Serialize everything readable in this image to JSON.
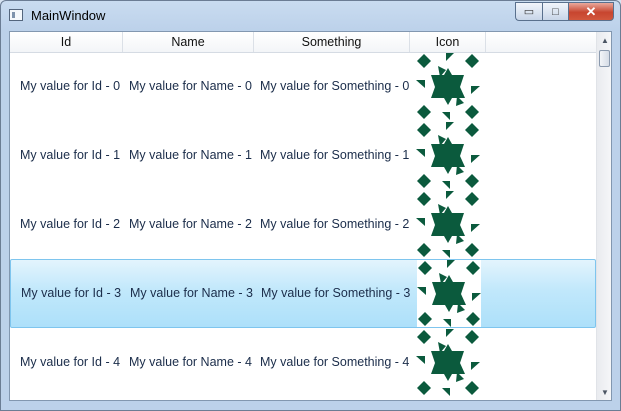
{
  "window": {
    "title": "MainWindow",
    "minimize_label": "▭",
    "maximize_label": "□",
    "close_label": "✕"
  },
  "columns": [
    "Id",
    "Name",
    "Something",
    "Icon"
  ],
  "rows": [
    {
      "id": "My value for Id - 0",
      "name": "My value for Name - 0",
      "something": "My value for Something - 0",
      "icon": "star-pattern-icon"
    },
    {
      "id": "My value for Id - 1",
      "name": "My value for Name - 1",
      "something": "My value for Something - 1",
      "icon": "star-pattern-icon"
    },
    {
      "id": "My value for Id - 2",
      "name": "My value for Name - 2",
      "something": "My value for Something - 2",
      "icon": "star-pattern-icon"
    },
    {
      "id": "My value for Id - 3",
      "name": "My value for Name - 3",
      "something": "My value for Something - 3",
      "icon": "star-pattern-icon"
    },
    {
      "id": "My value for Id - 4",
      "name": "My value for Name - 4",
      "something": "My value for Something - 4",
      "icon": "star-pattern-icon"
    }
  ],
  "selected_row": 3,
  "colors": {
    "icon_fill": "#0b5a3d",
    "selection": "#ade0fa"
  },
  "scrollbar": {
    "up_arrow": "▲",
    "down_arrow": "▼"
  }
}
